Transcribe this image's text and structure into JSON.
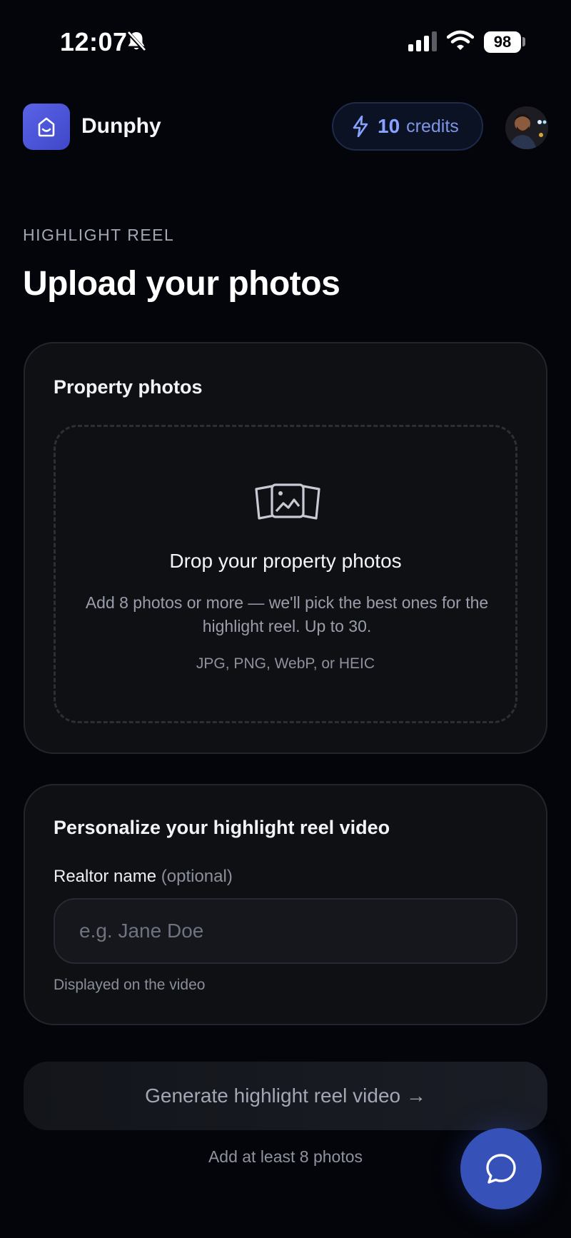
{
  "status_bar": {
    "time": "12:07",
    "battery": "98"
  },
  "header": {
    "brand_name": "Dunphy",
    "credits_count": "10",
    "credits_label": "credits"
  },
  "page": {
    "eyebrow": "HIGHLIGHT REEL",
    "title": "Upload your photos"
  },
  "photos_card": {
    "title": "Property photos",
    "dropzone_title": "Drop your property photos",
    "dropzone_description": "Add 8 photos or more — we'll pick the best ones for the highlight reel. Up to 30.",
    "formats": "JPG, PNG, WebP, or HEIC"
  },
  "personalize_card": {
    "title": "Personalize your highlight reel video",
    "realtor_label": "Realtor name",
    "realtor_optional": "(optional)",
    "realtor_value": "",
    "realtor_placeholder": "e.g. Jane Doe",
    "realtor_hint": "Displayed on the video"
  },
  "generate": {
    "button_label": "Generate highlight reel video →",
    "hint": "Add at least 8 photos"
  },
  "colors": {
    "background": "#04050a",
    "accent": "#5a63e6",
    "credits": "#8aa2ff",
    "chat_fab": "#3652b8"
  },
  "icons": [
    "bell-slash-icon",
    "signal-icon",
    "wifi-icon",
    "battery-icon",
    "smile-logo-icon",
    "bolt-icon",
    "photos-icon",
    "chat-bubble-icon"
  ]
}
